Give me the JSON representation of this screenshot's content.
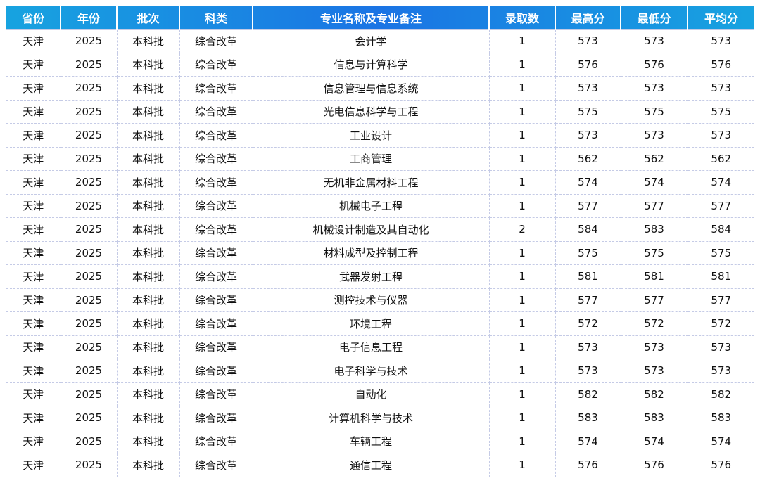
{
  "headers": [
    "省份",
    "年份",
    "批次",
    "科类",
    "专业名称及专业备注",
    "录取数",
    "最高分",
    "最低分",
    "平均分"
  ],
  "rows": [
    [
      "天津",
      "2025",
      "本科批",
      "综合改革",
      "会计学",
      "1",
      "573",
      "573",
      "573"
    ],
    [
      "天津",
      "2025",
      "本科批",
      "综合改革",
      "信息与计算科学",
      "1",
      "576",
      "576",
      "576"
    ],
    [
      "天津",
      "2025",
      "本科批",
      "综合改革",
      "信息管理与信息系统",
      "1",
      "573",
      "573",
      "573"
    ],
    [
      "天津",
      "2025",
      "本科批",
      "综合改革",
      "光电信息科学与工程",
      "1",
      "575",
      "575",
      "575"
    ],
    [
      "天津",
      "2025",
      "本科批",
      "综合改革",
      "工业设计",
      "1",
      "573",
      "573",
      "573"
    ],
    [
      "天津",
      "2025",
      "本科批",
      "综合改革",
      "工商管理",
      "1",
      "562",
      "562",
      "562"
    ],
    [
      "天津",
      "2025",
      "本科批",
      "综合改革",
      "无机非金属材料工程",
      "1",
      "574",
      "574",
      "574"
    ],
    [
      "天津",
      "2025",
      "本科批",
      "综合改革",
      "机械电子工程",
      "1",
      "577",
      "577",
      "577"
    ],
    [
      "天津",
      "2025",
      "本科批",
      "综合改革",
      "机械设计制造及其自动化",
      "2",
      "584",
      "583",
      "584"
    ],
    [
      "天津",
      "2025",
      "本科批",
      "综合改革",
      "材料成型及控制工程",
      "1",
      "575",
      "575",
      "575"
    ],
    [
      "天津",
      "2025",
      "本科批",
      "综合改革",
      "武器发射工程",
      "1",
      "581",
      "581",
      "581"
    ],
    [
      "天津",
      "2025",
      "本科批",
      "综合改革",
      "测控技术与仪器",
      "1",
      "577",
      "577",
      "577"
    ],
    [
      "天津",
      "2025",
      "本科批",
      "综合改革",
      "环境工程",
      "1",
      "572",
      "572",
      "572"
    ],
    [
      "天津",
      "2025",
      "本科批",
      "综合改革",
      "电子信息工程",
      "1",
      "573",
      "573",
      "573"
    ],
    [
      "天津",
      "2025",
      "本科批",
      "综合改革",
      "电子科学与技术",
      "1",
      "573",
      "573",
      "573"
    ],
    [
      "天津",
      "2025",
      "本科批",
      "综合改革",
      "自动化",
      "1",
      "582",
      "582",
      "582"
    ],
    [
      "天津",
      "2025",
      "本科批",
      "综合改革",
      "计算机科学与技术",
      "1",
      "583",
      "583",
      "583"
    ],
    [
      "天津",
      "2025",
      "本科批",
      "综合改革",
      "车辆工程",
      "1",
      "574",
      "574",
      "574"
    ],
    [
      "天津",
      "2025",
      "本科批",
      "综合改革",
      "通信工程",
      "1",
      "576",
      "576",
      "576"
    ]
  ]
}
